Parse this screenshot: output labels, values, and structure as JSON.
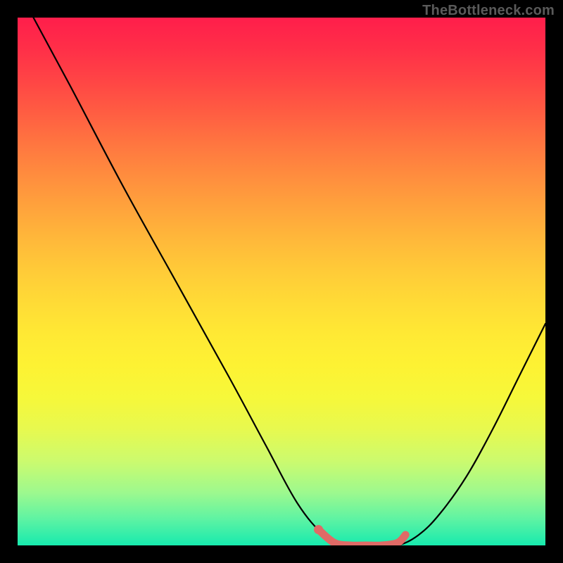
{
  "watermark": "TheBottleneck.com",
  "chart_data": {
    "type": "line",
    "title": "",
    "xlabel": "",
    "ylabel": "",
    "xlim": [
      0,
      100
    ],
    "ylim": [
      0,
      100
    ],
    "series": [
      {
        "name": "bottleneck-curve",
        "x": [
          3,
          10,
          20,
          30,
          40,
          47,
          53,
          58,
          62,
          65,
          68,
          72,
          76,
          80,
          85,
          90,
          95,
          100
        ],
        "values": [
          100,
          87,
          68,
          50,
          32,
          19,
          8,
          2,
          0,
          0,
          0,
          0,
          2,
          6,
          13,
          22,
          32,
          42
        ]
      }
    ],
    "highlight": {
      "name": "optimal-zone",
      "color": "#e06a66",
      "x": [
        57,
        60,
        63,
        66,
        69,
        72,
        73.5
      ],
      "values": [
        3,
        0.5,
        0,
        0,
        0,
        0.5,
        2
      ]
    },
    "colors": {
      "curve": "#000000",
      "highlight": "#e06a66",
      "gradient_top": "#ff1e4b",
      "gradient_bottom": "#17eaae",
      "frame": "#000000"
    }
  }
}
